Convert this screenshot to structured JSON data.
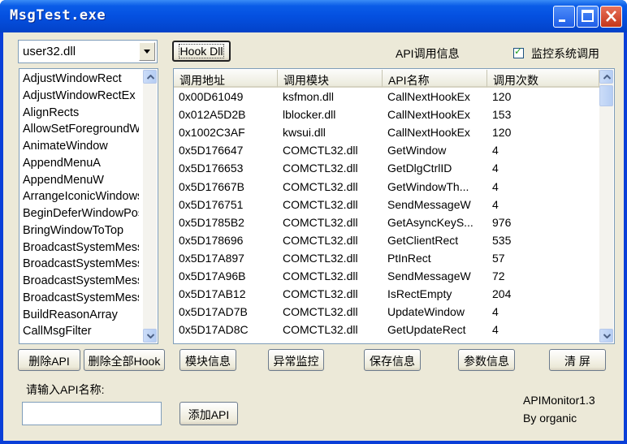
{
  "window": {
    "title": "MsgTest.exe"
  },
  "dll_select": {
    "value": "user32.dll"
  },
  "hook_button": "Hook Dll",
  "api_info_label": "API调用信息",
  "monitor_checkbox": {
    "label": "监控系统调用",
    "checked": true
  },
  "api_list": [
    "AdjustWindowRect",
    "AdjustWindowRectEx",
    "AlignRects",
    "AllowSetForegroundWindow",
    "AnimateWindow",
    "AppendMenuA",
    "AppendMenuW",
    "ArrangeIconicWindows",
    "BeginDeferWindowPos",
    "BringWindowToTop",
    "BroadcastSystemMessage",
    "BroadcastSystemMessageA",
    "BroadcastSystemMessageExA",
    "BroadcastSystemMessageW",
    "BuildReasonArray",
    "CallMsgFilter"
  ],
  "table": {
    "headers": [
      "调用地址",
      "调用模块",
      "API名称",
      "调用次数"
    ],
    "rows": [
      [
        "0x00D61049",
        "ksfmon.dll",
        "CallNextHookEx",
        "120"
      ],
      [
        "0x012A5D2B",
        "lblocker.dll",
        "CallNextHookEx",
        "153"
      ],
      [
        "0x1002C3AF",
        "kwsui.dll",
        "CallNextHookEx",
        "120"
      ],
      [
        "0x5D176647",
        "COMCTL32.dll",
        "GetWindow",
        "4"
      ],
      [
        "0x5D176653",
        "COMCTL32.dll",
        "GetDlgCtrlID",
        "4"
      ],
      [
        "0x5D17667B",
        "COMCTL32.dll",
        "GetWindowTh...",
        "4"
      ],
      [
        "0x5D176751",
        "COMCTL32.dll",
        "SendMessageW",
        "4"
      ],
      [
        "0x5D1785B2",
        "COMCTL32.dll",
        "GetAsyncKeyS...",
        "976"
      ],
      [
        "0x5D178696",
        "COMCTL32.dll",
        "GetClientRect",
        "535"
      ],
      [
        "0x5D17A897",
        "COMCTL32.dll",
        "PtInRect",
        "57"
      ],
      [
        "0x5D17A96B",
        "COMCTL32.dll",
        "SendMessageW",
        "72"
      ],
      [
        "0x5D17AB12",
        "COMCTL32.dll",
        "IsRectEmpty",
        "204"
      ],
      [
        "0x5D17AD7B",
        "COMCTL32.dll",
        "UpdateWindow",
        "4"
      ],
      [
        "0x5D17AD8C",
        "COMCTL32.dll",
        "GetUpdateRect",
        "4"
      ]
    ]
  },
  "buttons": {
    "delete_api": "删除API",
    "delete_all_hook": "删除全部Hook",
    "module_info": "模块信息",
    "exception_monitor": "异常监控",
    "save_info": "保存信息",
    "param_info": "参数信息",
    "clear": "清 屏",
    "add_api": "添加API"
  },
  "api_name_label": "请输入API名称:",
  "api_name_input": {
    "value": ""
  },
  "about": {
    "line1": "APIMonitor1.3",
    "line2": "By organic"
  }
}
